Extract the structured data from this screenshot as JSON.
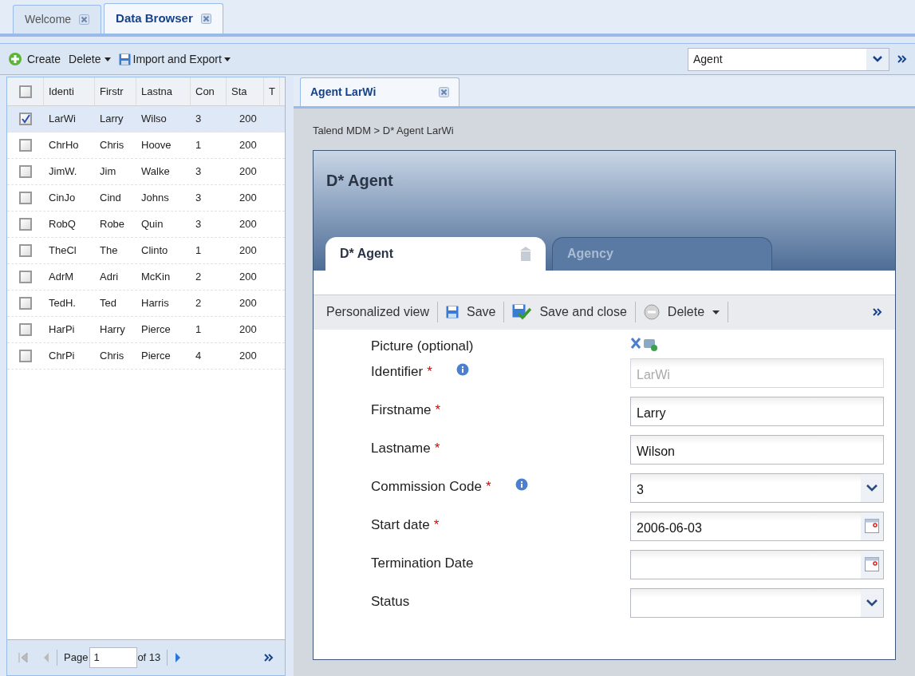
{
  "main_tabs": [
    {
      "label": "Welcome",
      "selected": false
    },
    {
      "label": "Data Browser",
      "selected": true
    }
  ],
  "toolbar": {
    "create": "Create",
    "delete": "Delete",
    "import_export": "Import and Export",
    "entity": "Agent"
  },
  "grid": {
    "all_checked": false,
    "columns": [
      "Identi",
      "Firstr",
      "Lastna",
      "Con",
      "Sta",
      "T"
    ],
    "rows": [
      {
        "checked": true,
        "cells": [
          "LarWi",
          "Larry",
          "Wilso",
          "3",
          "200"
        ]
      },
      {
        "checked": false,
        "cells": [
          "ChrHo",
          "Chris",
          "Hoove",
          "1",
          "200"
        ]
      },
      {
        "checked": false,
        "cells": [
          "JimW.",
          "Jim",
          "Walke",
          "3",
          "200"
        ]
      },
      {
        "checked": false,
        "cells": [
          "CinJo",
          "Cind",
          "Johns",
          "3",
          "200"
        ]
      },
      {
        "checked": false,
        "cells": [
          "RobQ",
          "Robe",
          "Quin",
          "3",
          "200"
        ]
      },
      {
        "checked": false,
        "cells": [
          "TheCl",
          "The",
          "Clinto",
          "1",
          "200"
        ]
      },
      {
        "checked": false,
        "cells": [
          "AdrM",
          "Adri",
          "McKin",
          "2",
          "200"
        ]
      },
      {
        "checked": false,
        "cells": [
          "TedH.",
          "Ted",
          "Harris",
          "2",
          "200"
        ]
      },
      {
        "checked": false,
        "cells": [
          "HarPi",
          "Harry",
          "Pierce",
          "1",
          "200"
        ]
      },
      {
        "checked": false,
        "cells": [
          "ChrPi",
          "Chris",
          "Pierce",
          "4",
          "200"
        ]
      }
    ]
  },
  "pager": {
    "label": "Page",
    "page": "1",
    "total": "of 13"
  },
  "detail_tabs": [
    {
      "label": "Agent LarWi",
      "selected": true
    }
  ],
  "breadcrumb": "Talend MDM > D* Agent LarWi",
  "card": {
    "title": "D* Agent",
    "tabs": [
      {
        "label": "D* Agent",
        "selected": true
      },
      {
        "label": "Agency",
        "selected": false
      }
    ],
    "actions": [
      {
        "kind": "text",
        "label": "Personalized view"
      },
      {
        "kind": "save",
        "label": "Save"
      },
      {
        "kind": "save_close",
        "label": "Save and close"
      },
      {
        "kind": "delete",
        "label": "Delete"
      }
    ],
    "fields": [
      {
        "kind": "picture",
        "label": "Picture (optional)"
      },
      {
        "kind": "text",
        "label": "Identifier",
        "required_mark": "*",
        "info": true,
        "value": "LarWi",
        "disabled": true
      },
      {
        "kind": "text",
        "label": "Firstname",
        "required_mark": "*",
        "info": false,
        "value": "Larry",
        "disabled": false
      },
      {
        "kind": "text",
        "label": "Lastname",
        "required_mark": "*",
        "info": false,
        "value": "Wilson",
        "disabled": false
      },
      {
        "kind": "select",
        "label": "Commission Code",
        "required_mark": "*",
        "info": true,
        "value": "3",
        "disabled": false
      },
      {
        "kind": "date",
        "label": "Start date",
        "required_mark": "*",
        "info": false,
        "value": "2006-06-03",
        "disabled": false
      },
      {
        "kind": "date",
        "label": "Termination Date",
        "info": false,
        "disabled": false
      },
      {
        "kind": "select",
        "label": "Status",
        "info": false,
        "disabled": false
      }
    ]
  }
}
